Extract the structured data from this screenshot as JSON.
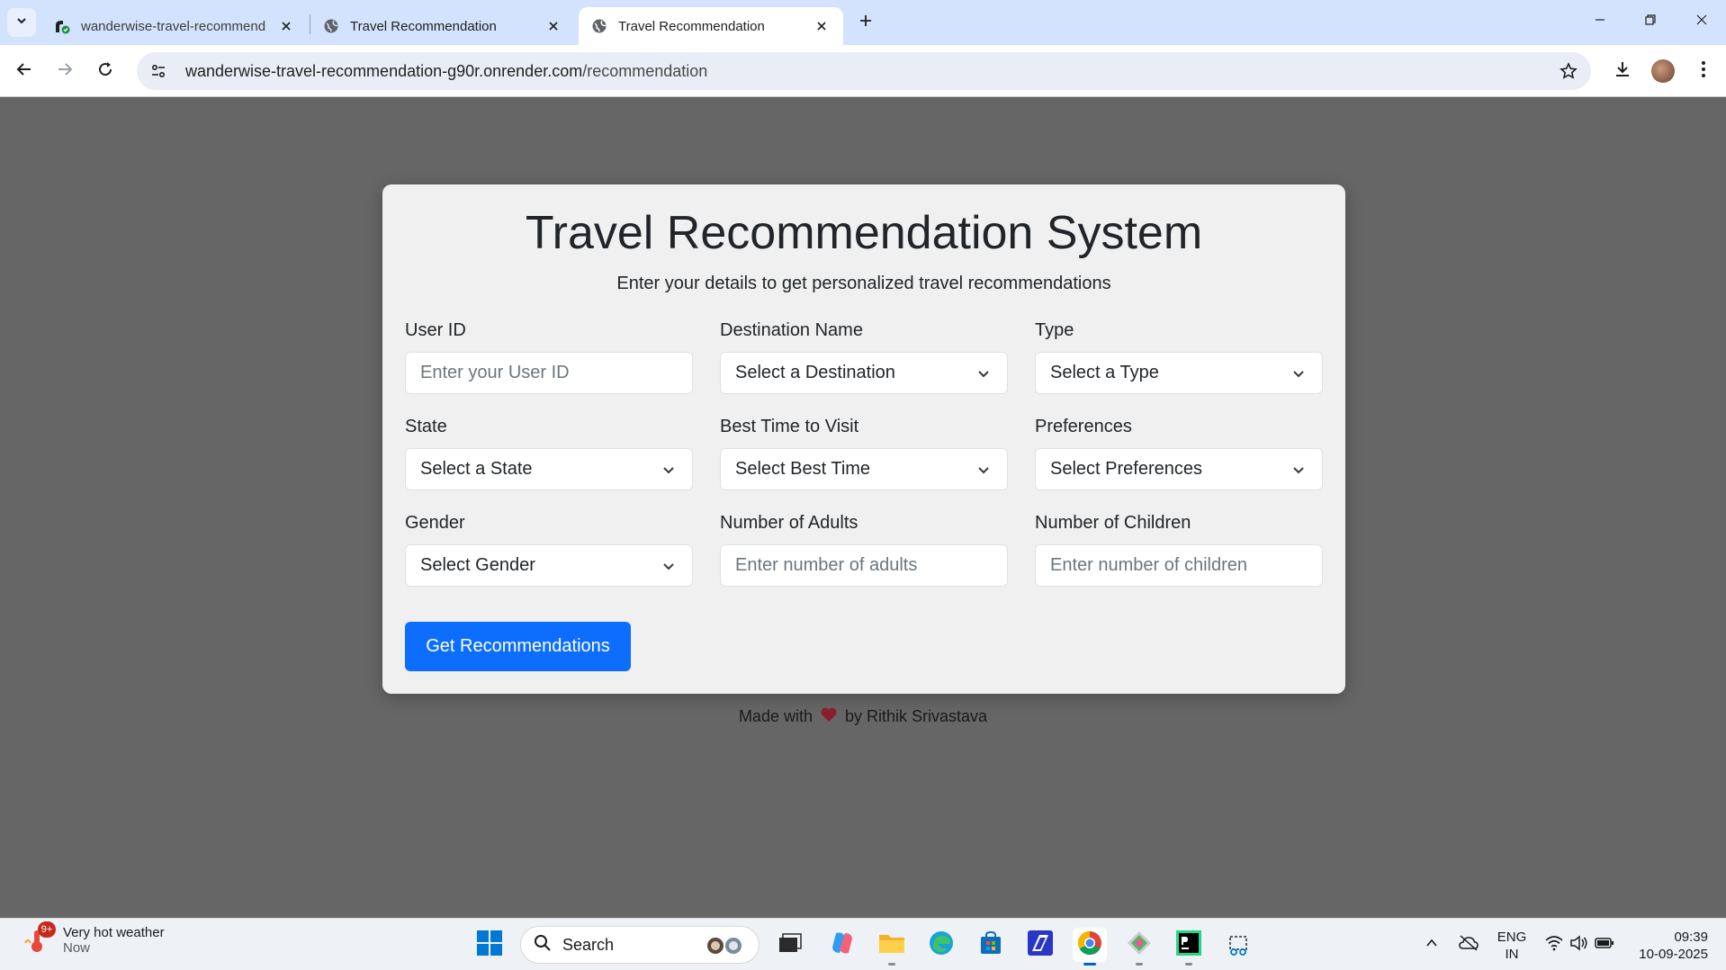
{
  "browser": {
    "tabs": [
      {
        "title": "wanderwise-travel-recommend",
        "active": false
      },
      {
        "title": "Travel Recommendation",
        "active": false
      },
      {
        "title": "Travel Recommendation",
        "active": true
      }
    ],
    "url_domain": "wanderwise-travel-recommendation-g90r.onrender.com",
    "url_path": "/recommendation"
  },
  "page": {
    "title": "Travel Recommendation System",
    "subtitle": "Enter your details to get personalized travel recommendations",
    "fields": {
      "user_id": {
        "label": "User ID",
        "placeholder": "Enter your User ID"
      },
      "destination": {
        "label": "Destination Name",
        "value": "Select a Destination"
      },
      "type": {
        "label": "Type",
        "value": "Select a Type"
      },
      "state": {
        "label": "State",
        "value": "Select a State"
      },
      "best_time": {
        "label": "Best Time to Visit",
        "value": "Select Best Time"
      },
      "preferences": {
        "label": "Preferences",
        "value": "Select Preferences"
      },
      "gender": {
        "label": "Gender",
        "value": "Select Gender"
      },
      "adults": {
        "label": "Number of Adults",
        "placeholder": "Enter number of adults"
      },
      "children": {
        "label": "Number of Children",
        "placeholder": "Enter number of children"
      }
    },
    "submit_label": "Get Recommendations",
    "footer": {
      "prefix": "Made with",
      "suffix": "by Rithik Srivastava"
    }
  },
  "taskbar": {
    "weather": {
      "title": "Very hot weather",
      "subtitle": "Now",
      "badge": "9+"
    },
    "search_label": "Search",
    "language": {
      "line1": "ENG",
      "line2": "IN"
    },
    "clock": {
      "time": "09:39",
      "date": "10-09-2025"
    }
  },
  "colors": {
    "accent": "#0d6efd",
    "page_background": "#666666",
    "card_background": "#f0f0f0",
    "tab_strip": "#d3e3fd",
    "heart": "#8b1e2b"
  }
}
